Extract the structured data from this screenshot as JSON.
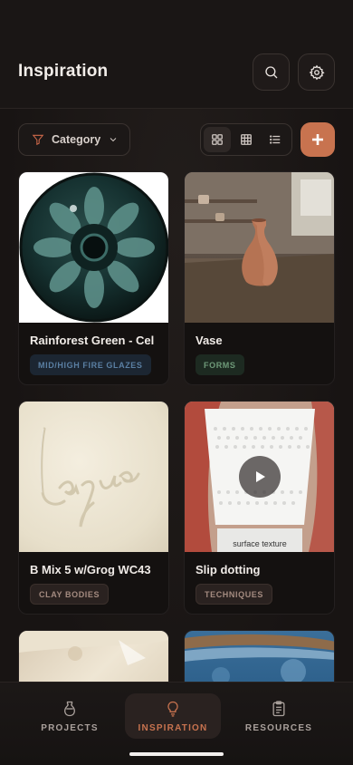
{
  "header": {
    "title": "Inspiration",
    "search_icon": "search-icon",
    "settings_icon": "gear-icon"
  },
  "toolbar": {
    "category_label": "Category",
    "views": [
      "grid-large-icon",
      "grid-small-icon",
      "list-icon"
    ],
    "active_view": "grid-large-icon",
    "add_icon": "plus-icon"
  },
  "cards": [
    {
      "name": "Rainforest Green - Cel",
      "tag": "MID/HIGH FIRE GLAZES",
      "tag_color": "#5a7fa3"
    },
    {
      "name": "Vase",
      "tag": "FORMS",
      "tag_color": "#6e9a79"
    },
    {
      "name": "B Mix 5 w/Grog WC43",
      "tag": "CLAY BODIES",
      "tag_color": "#a48b80"
    },
    {
      "name": "Slip dotting",
      "tag": "TECHNIQUES",
      "tag_color": "#a48b80"
    },
    {
      "name": "",
      "tag": ""
    },
    {
      "name": "",
      "tag": ""
    }
  ],
  "slip_image_text": "surface texture",
  "nav": [
    {
      "label": "PROJECTS",
      "icon": "vase-icon"
    },
    {
      "label": "INSPIRATION",
      "icon": "lightbulb-icon",
      "active": true
    },
    {
      "label": "RESOURCES",
      "icon": "clipboard-icon"
    }
  ],
  "colors": {
    "accent": "#c8734f",
    "background": "#1b1716"
  }
}
